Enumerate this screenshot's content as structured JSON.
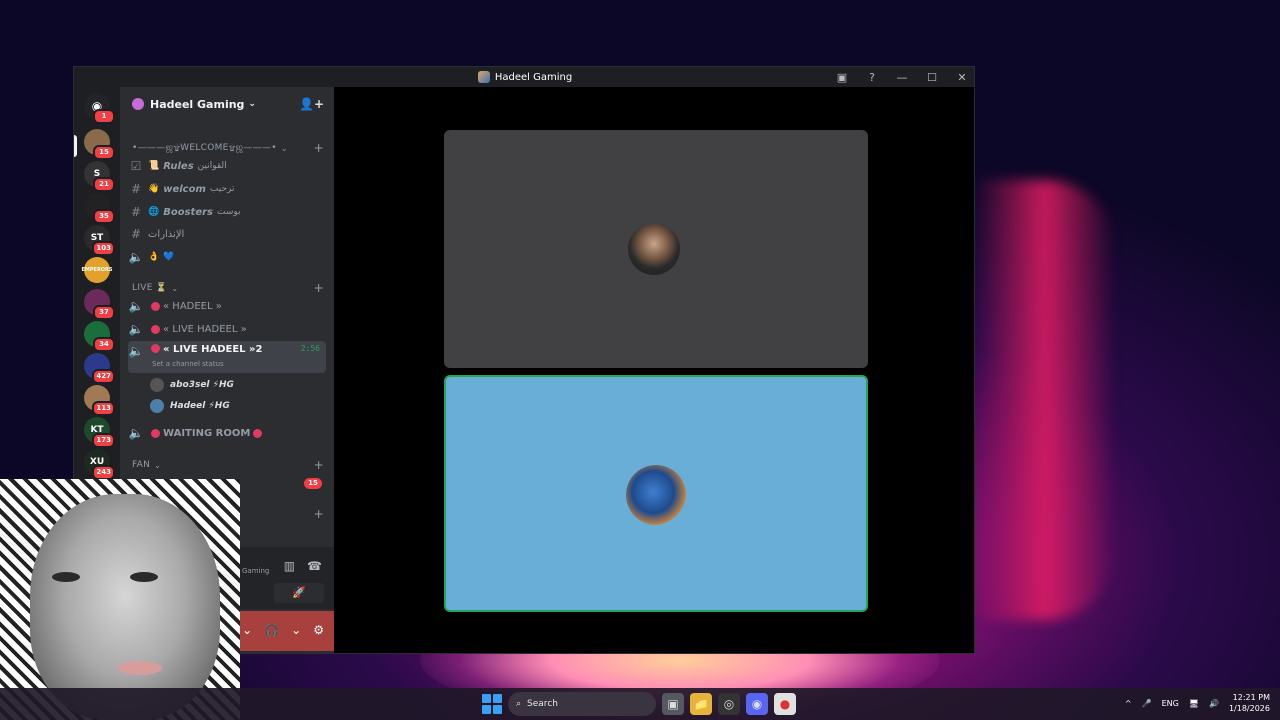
{
  "window": {
    "title": "Hadeel Gaming"
  },
  "server": {
    "name": "Hadeel Gaming"
  },
  "rail": {
    "dm_badge": "1",
    "servers": [
      {
        "label": "",
        "badge": "15",
        "color": "#8a6a4a"
      },
      {
        "label": "S",
        "badge": "21",
        "color": "#333"
      },
      {
        "label": "",
        "badge": "35",
        "color": "#222"
      },
      {
        "label": "ST",
        "badge": "103",
        "color": "#2b2b2b"
      },
      {
        "label": "EMPERORS",
        "badge": "",
        "color": "#e3a12b"
      },
      {
        "label": "",
        "badge": "37",
        "color": "#6a2b5a"
      },
      {
        "label": "",
        "badge": "34",
        "color": "#1b6e3b"
      },
      {
        "label": "",
        "badge": "427",
        "color": "#2c3a8c"
      },
      {
        "label": "",
        "badge": "113",
        "color": "#a07a55"
      },
      {
        "label": "KT",
        "badge": "173",
        "color": "#1d4a2a"
      },
      {
        "label": "XU",
        "badge": "243",
        "color": "#1d2a20"
      }
    ]
  },
  "channels": {
    "category_welcome": "•———ஜ۩Welcome۩ஜ———•",
    "rules": "Rules",
    "rules_ar": "القوانين",
    "welcom": "welcom",
    "welcom_ar": "ترحيب",
    "boosters": "Boosters",
    "boosters_ar": "بوست",
    "announcements": "الإنذارات",
    "category_live": "LIVE ⏳",
    "ch_hadeel": "« HADEEL »",
    "ch_live1": "« LIVE HADEEL »",
    "ch_live2": "« LIVE HADEEL »2",
    "timer": "2:56",
    "set_status": "Set a channel status",
    "user1": "abo3sel ⚡HG",
    "user2": "Hadeel ⚡HG",
    "waiting": "WAITING ROOM",
    "category_fan": "FAN",
    "fan_badge": "15"
  },
  "voice_panel": {
    "gaming": "Gaming"
  },
  "taskbar": {
    "search": "Search",
    "lang": "ENG",
    "time": "12:21 PM",
    "date": "1/18/2026"
  }
}
